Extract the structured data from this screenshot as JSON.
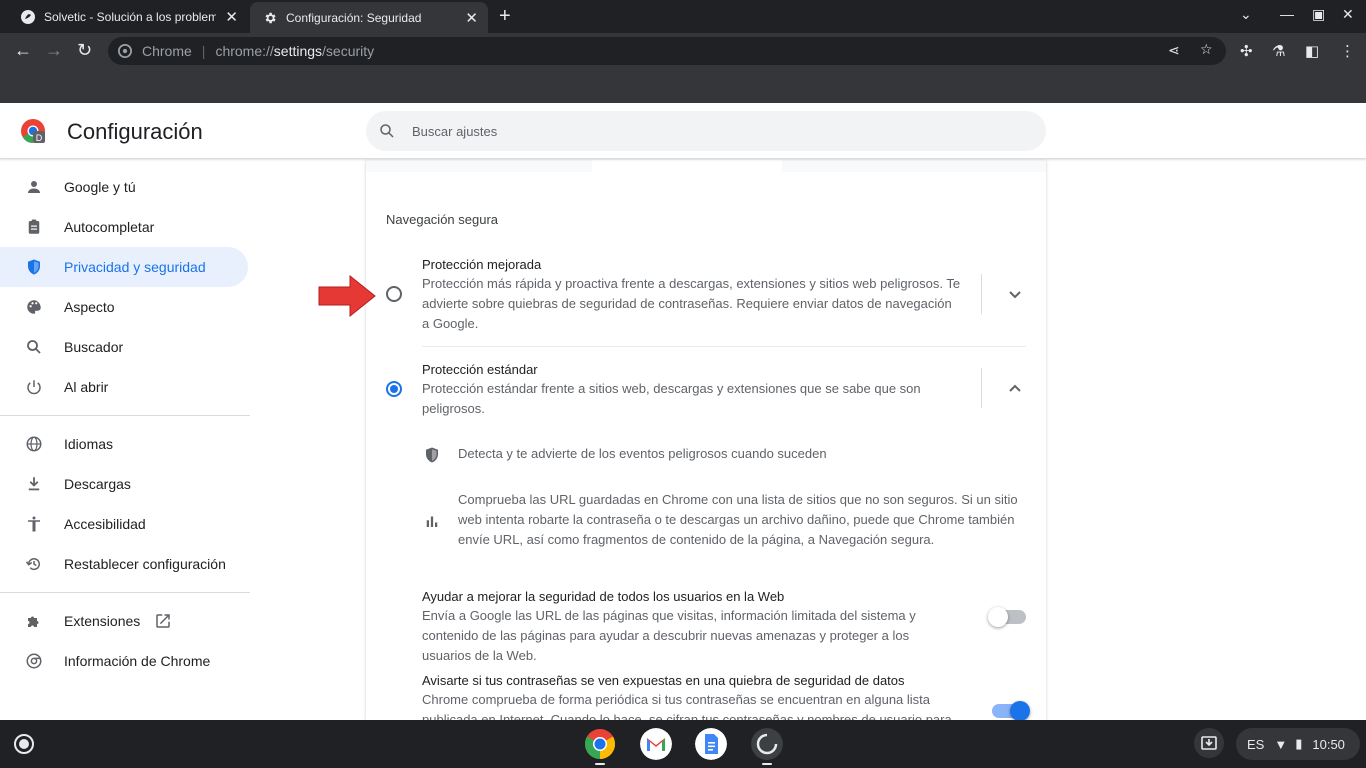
{
  "browser": {
    "tabs": [
      {
        "title": "Solvetic - Solución a los problem",
        "active": false
      },
      {
        "title": "Configuración: Seguridad",
        "active": true
      }
    ],
    "omnibox": {
      "site_label": "Chrome",
      "url_scheme": "chrome://",
      "url_host": "settings",
      "url_path": "/security"
    }
  },
  "header": {
    "title": "Configuración",
    "search_placeholder": "Buscar ajustes"
  },
  "sidebar": {
    "items": [
      {
        "label": "Google y tú",
        "icon": "person-icon"
      },
      {
        "label": "Autocompletar",
        "icon": "clipboard-icon"
      },
      {
        "label": "Privacidad y seguridad",
        "icon": "shield-icon",
        "active": true
      },
      {
        "label": "Aspecto",
        "icon": "palette-icon"
      },
      {
        "label": "Buscador",
        "icon": "search-icon"
      },
      {
        "label": "Al abrir",
        "icon": "power-icon"
      },
      {
        "label": "Idiomas",
        "icon": "globe-icon"
      },
      {
        "label": "Descargas",
        "icon": "download-icon"
      },
      {
        "label": "Accesibilidad",
        "icon": "accessibility-icon"
      },
      {
        "label": "Restablecer configuración",
        "icon": "restore-icon"
      },
      {
        "label": "Extensiones",
        "icon": "puzzle-icon"
      },
      {
        "label": "Información de Chrome",
        "icon": "chrome-icon"
      }
    ]
  },
  "main": {
    "section_title": "Navegación segura",
    "options": [
      {
        "title": "Protección mejorada",
        "description": "Protección más rápida y proactiva frente a descargas, extensiones y sitios web peligrosos. Te advierte sobre quiebras de seguridad de contraseñas. Requiere enviar datos de navegación a Google.",
        "selected": false
      },
      {
        "title": "Protección estándar",
        "description": "Protección estándar frente a sitios web, descargas y extensiones que se sabe que son peligrosos.",
        "selected": true
      }
    ],
    "standard_details": [
      {
        "icon": "shield-icon",
        "text": "Detecta y te advierte de los eventos peligrosos cuando suceden"
      },
      {
        "icon": "bar-chart-icon",
        "text": "Comprueba las URL guardadas en Chrome con una lista de sitios que no son seguros. Si un sitio web intenta robarte la contraseña o te descargas un archivo dañino, puede que Chrome también envíe URL, así como fragmentos de contenido de la página, a Navegación segura."
      }
    ],
    "toggles": [
      {
        "title": "Ayudar a mejorar la seguridad de todos los usuarios en la Web",
        "description": "Envía a Google las URL de las páginas que visitas, información limitada del sistema y contenido de las páginas para ayudar a descubrir nuevas amenazas y proteger a los usuarios de la Web.",
        "on": false
      },
      {
        "title": "Avisarte si tus contraseñas se ven expuestas en una quiebra de seguridad de datos",
        "description": "Chrome comprueba de forma periódica si tus contraseñas se encuentran en alguna lista publicada en Internet. Cuando lo hace, se cifran tus contraseñas y nombres de usuario para que",
        "on": true
      }
    ]
  },
  "shelf": {
    "language": "ES",
    "time": "10:50"
  },
  "colors": {
    "accent": "#1a73e8",
    "active_nav_bg": "#e8f0fe",
    "arrow": "#e53935"
  }
}
